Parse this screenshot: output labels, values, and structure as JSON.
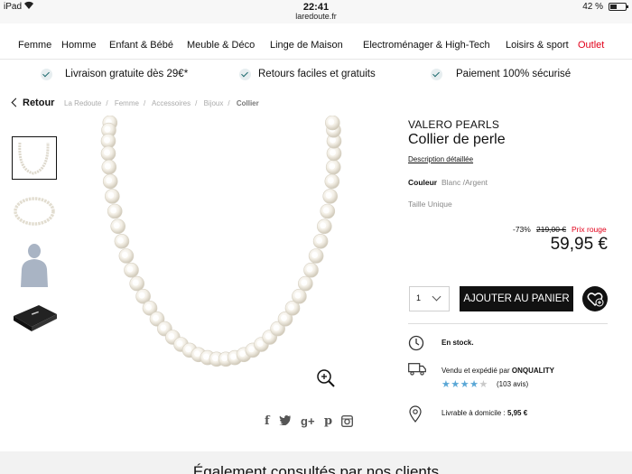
{
  "status_bar": {
    "device": "iPad",
    "time": "22:41",
    "domain": "laredoute.fr",
    "battery": "42 %"
  },
  "nav": {
    "items": [
      {
        "label": "Femme"
      },
      {
        "label": "Homme"
      },
      {
        "label": "Enfant & Bébé"
      },
      {
        "label": "Meuble & Déco"
      },
      {
        "label": "Linge de Maison"
      },
      {
        "label": "Electroménager & High-Tech"
      },
      {
        "label": "Loisirs & sport"
      },
      {
        "label": "Outlet",
        "color": "#e2001a"
      }
    ]
  },
  "reassurance": [
    {
      "label": "Livraison gratuite dès 29€*"
    },
    {
      "label": "Retours faciles et gratuits"
    },
    {
      "label": "Paiement 100% sécurisé"
    }
  ],
  "breadcrumb": {
    "back": "Retour",
    "items": [
      "La Redoute",
      "Femme",
      "Accessoires",
      "Bijoux",
      "Collier"
    ]
  },
  "product": {
    "brand": "VALERO PEARLS",
    "title": "Collier de perle",
    "desc_link": "Description détaillée",
    "color_label": "Couleur",
    "color_value": "Blanc /Argent",
    "size": "Taille Unique",
    "discount": "-73%",
    "old_price": "219,00 €",
    "price_label": "Prix rouge",
    "price": "59,95 €",
    "qty": "1",
    "add_to_cart": "AJOUTER AU PANIER",
    "stock": "En stock.",
    "seller_prefix": "Vendu et expédié par",
    "seller": "ONQUALITY",
    "rating": 4,
    "rating_max": 5,
    "reviews": "(103 avis)",
    "delivery_prefix": "Livrable à domicile :",
    "delivery_price": "5,95 €"
  },
  "bottom": {
    "heading": "Également consultés par nos clients"
  },
  "colors": {
    "accent": "#e2001a",
    "button": "#111111",
    "stars": "#5aa7d6"
  },
  "icons": [
    "wifi-icon",
    "battery-icon",
    "check-icon",
    "chevron-left-icon",
    "zoom-in-icon",
    "facebook-icon",
    "twitter-icon",
    "googleplus-icon",
    "pinterest-icon",
    "instagram-icon",
    "chevron-down-icon",
    "heart-add-icon",
    "clock-icon",
    "truck-icon",
    "location-pin-icon",
    "star-icon"
  ]
}
